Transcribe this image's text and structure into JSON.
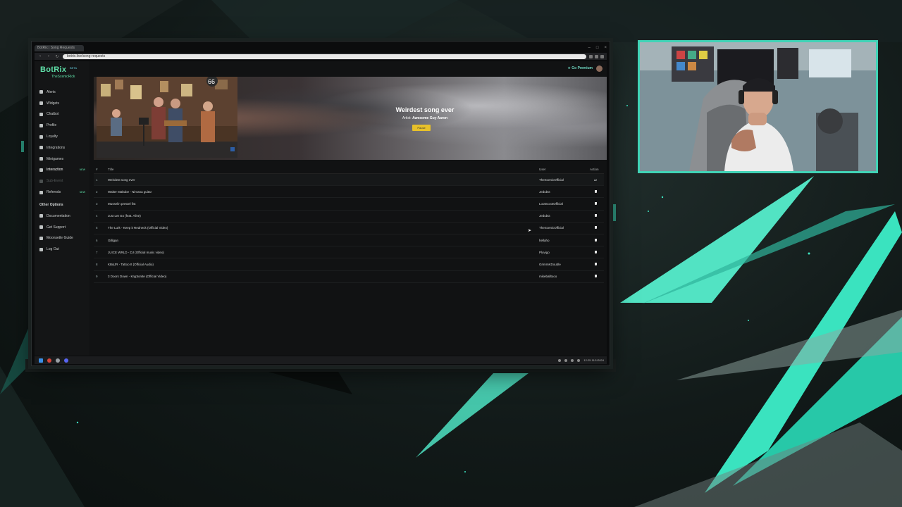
{
  "stream_overlay": {
    "accent_color": "#3ee6c2"
  },
  "browser": {
    "tab_title": "BotRix | Song Requests",
    "url": "botrix.live/song-requests",
    "win_controls": [
      "–",
      "□",
      "×"
    ],
    "nav_icons": [
      "back-icon",
      "forward-icon",
      "refresh-icon"
    ]
  },
  "app": {
    "brand": "BotRix",
    "brand_badge": "BETA",
    "user": "TheScenicRick",
    "header_cta": "Go Premium",
    "sidebar": {
      "items": [
        {
          "label": "Alerts",
          "icon": "bell-icon"
        },
        {
          "label": "Widgets",
          "icon": "widget-icon"
        },
        {
          "label": "Chatbot",
          "icon": "robot-icon"
        },
        {
          "label": "Profile",
          "icon": "user-icon"
        },
        {
          "label": "Loyalty",
          "icon": "coin-icon"
        },
        {
          "label": "Integrations",
          "icon": "plug-icon"
        },
        {
          "label": "Minigames",
          "icon": "gamepad-icon"
        },
        {
          "label": "Interaction",
          "icon": "music-icon",
          "badge": "NEW"
        },
        {
          "label": "Sub-Event",
          "icon": "star-icon"
        },
        {
          "label": "Referrals",
          "icon": "users-icon",
          "badge": "NEW"
        }
      ],
      "other_heading": "Other Options",
      "other_items": [
        {
          "label": "Documentation",
          "icon": "book-icon"
        },
        {
          "label": "Get Support",
          "icon": "support-icon"
        },
        {
          "label": "Moonsetle Guide",
          "icon": "guide-icon"
        },
        {
          "label": "Log Out",
          "icon": "logout-icon"
        }
      ]
    },
    "now_playing": {
      "title": "Weirdest song ever",
      "artist_label": "Artist:",
      "artist": "Awesome Guy Aaron",
      "button": "Pause"
    },
    "table": {
      "columns": [
        "#",
        "Title",
        "User",
        "Action"
      ],
      "rows": [
        {
          "num": "1",
          "title": "Weirdest song ever",
          "user": "TheScenicOfficial",
          "active": true
        },
        {
          "num": "2",
          "title": "Walter Maltube - Nirvana guitar",
          "user": "JedubG"
        },
        {
          "num": "3",
          "title": "Musselin pretzel fist",
          "user": "LootScootOfficial"
        },
        {
          "num": "4",
          "title": "Just Let Go (feat. Alive)",
          "user": "JedubG"
        },
        {
          "num": "5",
          "title": "The Lurk - Keep it Redneck (Official Video)",
          "user": "TheScenicOfficial"
        },
        {
          "num": "6",
          "title": "Gilligan",
          "user": "hellaho"
        },
        {
          "num": "7",
          "title": "JUICE WRLD - DJ (Official music video)",
          "user": "Pluvigo"
        },
        {
          "num": "8",
          "title": "KB&JR - Tattoo It (Official Audio)",
          "user": "GrimmKDouble"
        },
        {
          "num": "9",
          "title": "3 Doors Down - Kryptonite (Official Video)",
          "user": "mikeballtooo"
        }
      ]
    }
  },
  "taskbar": {
    "time": "12:25",
    "date": "11/1/2024"
  },
  "webcam": {
    "border_color": "#41d3b6"
  }
}
